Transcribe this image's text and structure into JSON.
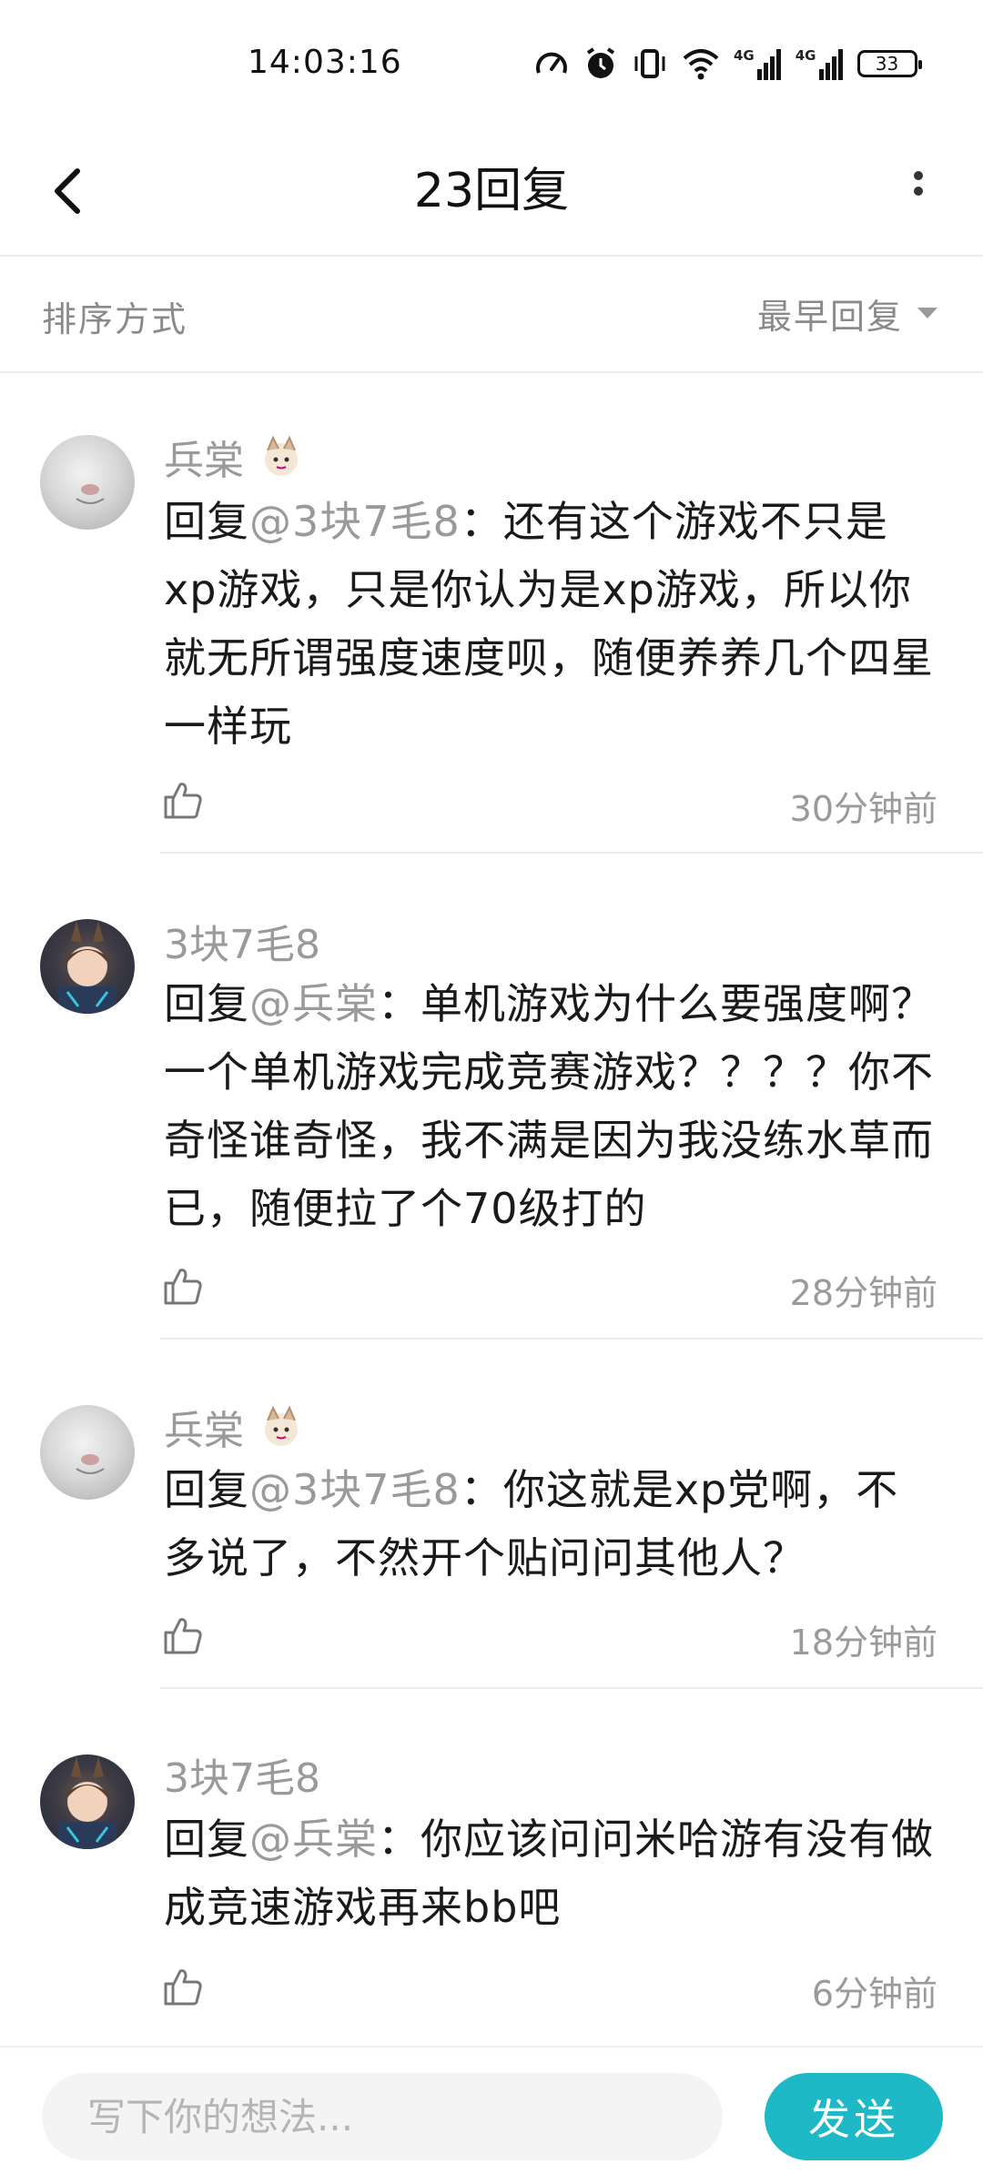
{
  "status_bar": {
    "time": "14:03:16",
    "signal_labels": [
      "4G",
      "4G"
    ],
    "battery": "33"
  },
  "header": {
    "title": "23回复"
  },
  "sort": {
    "label": "排序方式",
    "value": "最早回复"
  },
  "comments": [
    {
      "username": "兵棠",
      "reply_prefix": "回复",
      "mention": "@3块7毛8",
      "text": "：还有这个游戏不只是xp游戏，只是你认为是xp游戏，所以你就无所谓强度速度呗，随便养养几个四星一样玩",
      "time": "30分钟前"
    },
    {
      "username": "3块7毛8",
      "reply_prefix": "回复",
      "mention": "@兵棠",
      "text": "：单机游戏为什么要强度啊？一个单机游戏完成竞赛游戏？？？？你不奇怪谁奇怪，我不满是因为我没练水草而已，随便拉了个70级打的",
      "time": "28分钟前"
    },
    {
      "username": "兵棠",
      "reply_prefix": "回复",
      "mention": "@3块7毛8",
      "text": "：你这就是xp党啊，不多说了，不然开个贴问问其他人？",
      "time": "18分钟前"
    },
    {
      "username": "3块7毛8",
      "reply_prefix": "回复",
      "mention": "@兵棠",
      "text": "：你应该问问米哈游有没有做成竞速游戏再来bb吧",
      "time": "6分钟前"
    }
  ],
  "input": {
    "placeholder": "写下你的想法..."
  },
  "send": {
    "label": "发送"
  },
  "colors": {
    "accent": "#1fb8c7",
    "muted_text": "#9a9a9a",
    "divider": "#ececec"
  }
}
